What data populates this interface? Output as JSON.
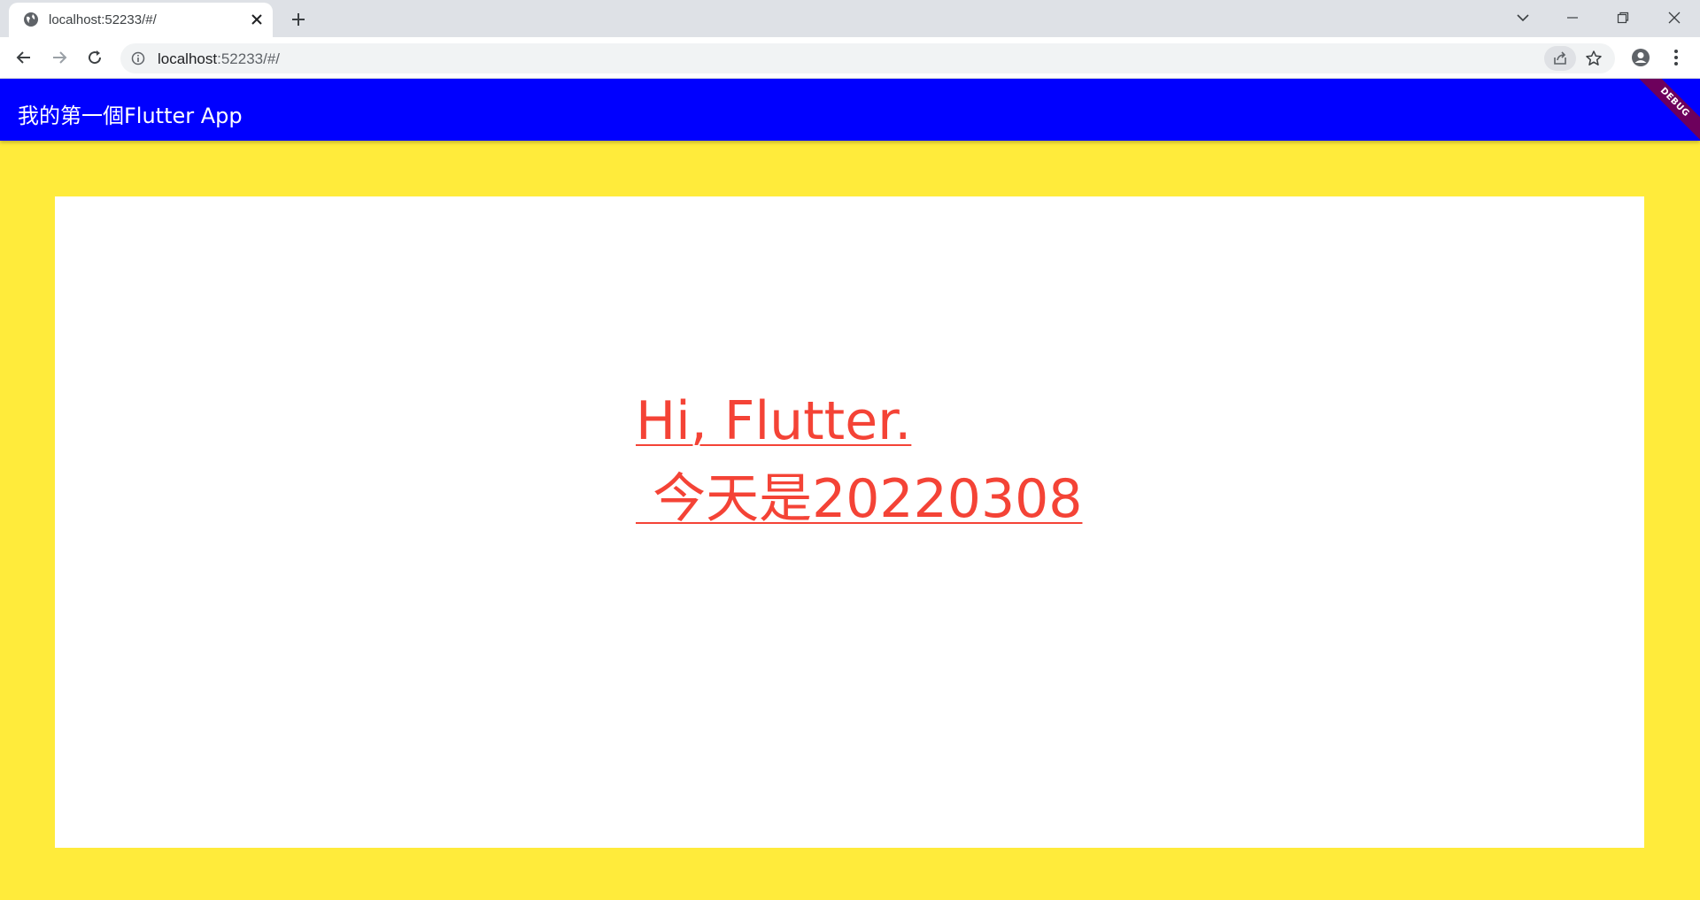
{
  "browser": {
    "tab_title": "localhost:52233/#/",
    "url_host": "localhost",
    "url_rest": ":52233/#/"
  },
  "app": {
    "title": "我的第一個Flutter App",
    "debug_label": "DEBUG",
    "text_line1": "Hi, Flutter.",
    "text_line2": " 今天是20220308"
  },
  "colors": {
    "appbar": "#0000ff",
    "background": "#ffeb3b",
    "card": "#ffffff",
    "text": "#f44336"
  }
}
